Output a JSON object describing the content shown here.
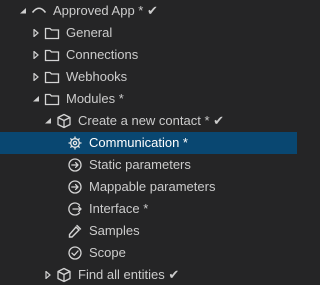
{
  "tree": {
    "root": {
      "label": "Approved App * ✔"
    },
    "general": {
      "label": "General"
    },
    "connections": {
      "label": "Connections"
    },
    "webhooks": {
      "label": "Webhooks"
    },
    "modules": {
      "label": "Modules *"
    },
    "create_contact": {
      "label": "Create a new contact * ✔"
    },
    "communication": {
      "label": "Communication *"
    },
    "static_parameters": {
      "label": "Static parameters"
    },
    "mappable_parameters": {
      "label": "Mappable parameters"
    },
    "interface": {
      "label": "Interface *"
    },
    "samples": {
      "label": "Samples"
    },
    "scope": {
      "label": "Scope"
    },
    "find_all_entities": {
      "label": "Find all entities ✔"
    }
  },
  "colors": {
    "background": "#252526",
    "selection": "#094771",
    "text": "#cccccc",
    "icon": "#d4d4d4"
  }
}
